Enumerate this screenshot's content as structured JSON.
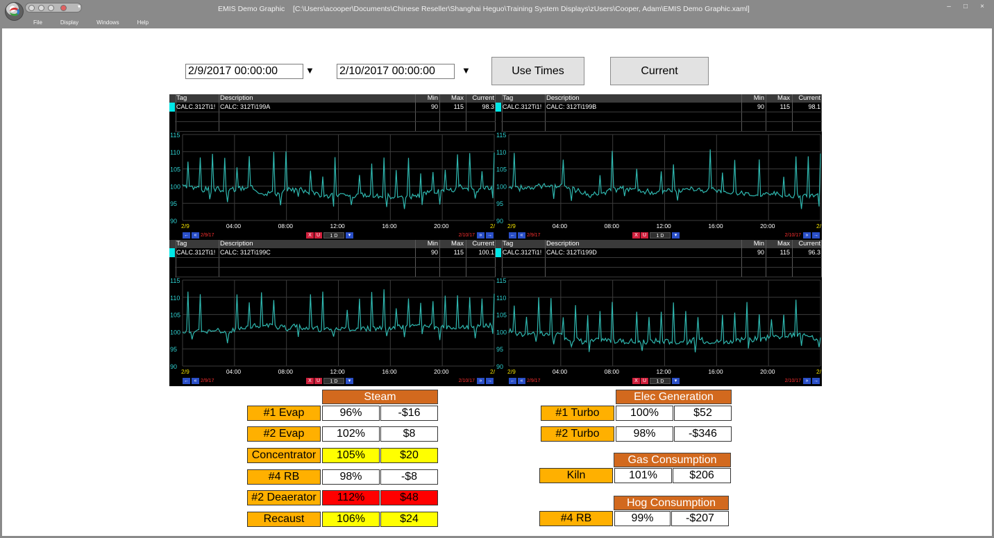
{
  "window": {
    "title": "EMIS Demo Graphic    [C:\\Users\\acooper\\Documents\\Chinese Reseller\\Shanghai Heguo\\Training System Displays\\zUsers\\Cooper, Adam\\EMIS Demo Graphic.xaml]",
    "menu": [
      "File",
      "Display",
      "Windows",
      "Help"
    ],
    "controls": {
      "minimize": "–",
      "maximize": "□",
      "close": "×"
    }
  },
  "time_controls": {
    "start": "2/9/2017 00:00:00",
    "end": "2/10/2017 00:00:00",
    "dropdown_glyph": "▼",
    "use_times_label": "Use Times",
    "current_label": "Current"
  },
  "trend_common": {
    "columns": [
      "Tag",
      "Description",
      "Min",
      "Max",
      "Current"
    ],
    "y_ticks": [
      "115",
      "110",
      "105",
      "100",
      "95",
      "90"
    ],
    "x_ticks": [
      "2/9",
      "04:00",
      "08:00",
      "12:00",
      "16:00",
      "20:00",
      "2/"
    ],
    "nav_start": "2/9/17",
    "nav_end": "2/10/17",
    "range": "1 D",
    "btn_x": "X",
    "btn_u": "U",
    "line_color": "#2fb8b0",
    "ylim": [
      90,
      115
    ]
  },
  "trends": [
    {
      "tag": "CALC.312Ti1!",
      "description": "CALC: 312Ti199A",
      "min": "90",
      "max": "115",
      "current": "98.3"
    },
    {
      "tag": "CALC.312Ti1!",
      "description": "CALC: 312Ti199B",
      "min": "90",
      "max": "115",
      "current": "98.1"
    },
    {
      "tag": "CALC.312Ti1!",
      "description": "CALC: 312Ti199C",
      "min": "90",
      "max": "115",
      "current": "100.1"
    },
    {
      "tag": "CALC.312Ti1!",
      "description": "CALC: 312Ti199D",
      "min": "90",
      "max": "115",
      "current": "96.3"
    }
  ],
  "steam": {
    "title": "Steam",
    "rows": [
      {
        "label": "#1 Evap",
        "pct": "96%",
        "cost": "-$16",
        "color": "white"
      },
      {
        "label": "#2 Evap",
        "pct": "102%",
        "cost": "$8",
        "color": "white"
      },
      {
        "label": "Concentrator",
        "pct": "105%",
        "cost": "$20",
        "color": "yellow"
      },
      {
        "label": "#4 RB",
        "pct": "98%",
        "cost": "-$8",
        "color": "white"
      },
      {
        "label": "#2 Deaerator",
        "pct": "112%",
        "cost": "$48",
        "color": "red"
      },
      {
        "label": "Recaust",
        "pct": "106%",
        "cost": "$24",
        "color": "yellow"
      }
    ]
  },
  "elec": {
    "title": "Elec Generation",
    "rows": [
      {
        "label": "#1 Turbo",
        "pct": "100%",
        "cost": "$52"
      },
      {
        "label": "#2 Turbo",
        "pct": "98%",
        "cost": "-$346"
      }
    ]
  },
  "gas": {
    "title": "Gas Consumption",
    "label": "Kiln",
    "pct": "101%",
    "cost": "$206"
  },
  "hog": {
    "title": "Hog Consumption",
    "label": "#4 RB",
    "pct": "99%",
    "cost": "-$207"
  }
}
